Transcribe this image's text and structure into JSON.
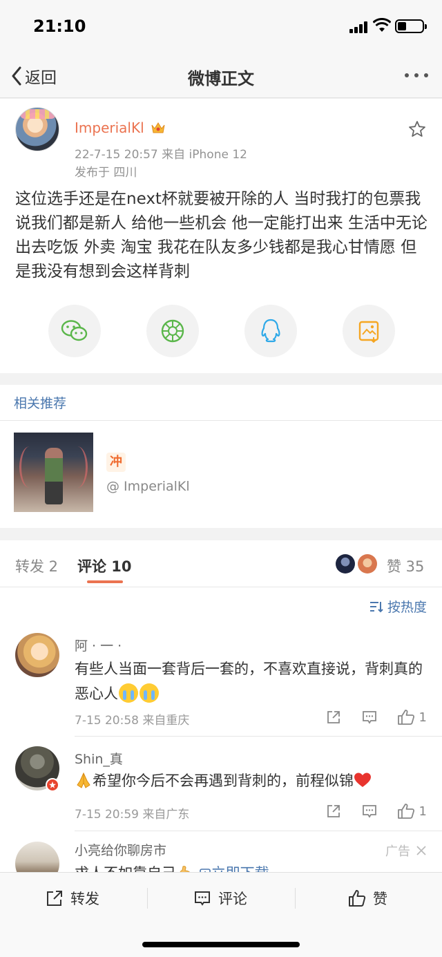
{
  "status_bar": {
    "time": "21:10"
  },
  "nav": {
    "back_label": "返回",
    "title": "微博正文"
  },
  "post": {
    "username": "ImperialKl",
    "meta": "22-7-15 20:57  来自 iPhone 12",
    "location": "发布于 四川",
    "text": "这位选手还是在next杯就要被开除的人  当时我打的包票我说我们都是新人 给他一些机会 他一定能打出来 生活中无论出去吃饭 外卖 淘宝  我花在队友多少钱都是我心甘情愿 但是我没有想到会这样背刺",
    "share_icons": [
      "wechat-icon",
      "moments-icon",
      "qq-icon",
      "save-image-icon"
    ]
  },
  "related": {
    "title": "相关推荐",
    "badge": "冲",
    "author": "@ ImperialKl"
  },
  "tabs": {
    "repost": "转发 2",
    "comment": "评论 10",
    "like": "赞 35"
  },
  "sort_label": "按热度",
  "comments": [
    {
      "name": "阿 · 一 ·",
      "text": "有些人当面一套背后一套的，不喜欢直接说，背刺真的恶心人",
      "meta": "7-15 20:58  来自重庆",
      "likes": "1"
    },
    {
      "name": "Shin_真",
      "text": "希望你今后不会再遇到背刺的，前程似锦",
      "meta": "7-15 20:59  来自广东",
      "likes": "1"
    }
  ],
  "ad": {
    "name": "小亮给你聊房市",
    "label": "广告",
    "text": "求人不如靠自己",
    "link": "立即下载"
  },
  "bottom_bar": {
    "repost": "转发",
    "comment": "评论",
    "like": "赞"
  },
  "colors": {
    "accent": "#eb7350",
    "link": "#4a77ae"
  }
}
